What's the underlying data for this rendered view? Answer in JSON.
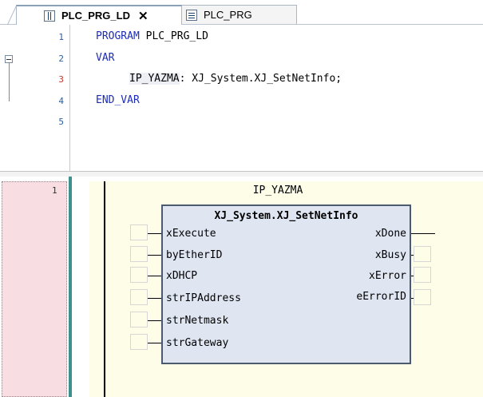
{
  "tabs": [
    {
      "label": "PLC_PRG_LD",
      "close": "✕",
      "icon": "ladder-pou-icon"
    },
    {
      "label": "PLC_PRG",
      "icon": "st-pou-icon"
    }
  ],
  "declaration": {
    "line_numbers": [
      "1",
      "2",
      "3",
      "4",
      "5"
    ],
    "lines": {
      "l1_kw": "PROGRAM",
      "l1_name": " PLC_PRG_LD",
      "l2_kw": "VAR",
      "l3_var": "IP_YAZMA",
      "l3_rest": ": XJ_System.XJ_SetNetInfo;",
      "l4_kw": "END_VAR"
    }
  },
  "ladder": {
    "rung_number": "1",
    "instance_name": "IP_YAZMA",
    "fb_type": "XJ_System.XJ_SetNetInfo",
    "inputs": [
      "xExecute",
      "byEtherID",
      "xDHCP",
      "strIPAddress",
      "strNetmask",
      "strGateway"
    ],
    "outputs": [
      "xDone",
      "xBusy",
      "xError",
      "eErrorID"
    ]
  },
  "colors": {
    "keyword": "#1c2cb8",
    "rung_gutter": "#f8dde3",
    "rung_area": "#fdfde8",
    "fb_fill": "#dfe6f2"
  }
}
